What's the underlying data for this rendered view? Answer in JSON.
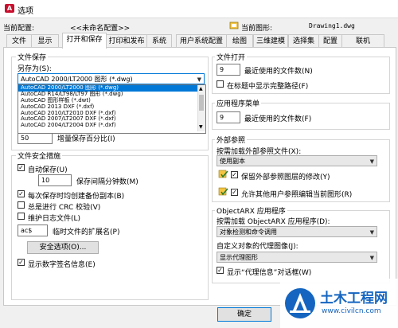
{
  "window": {
    "title": "选项"
  },
  "profile": {
    "current_profile_label": "当前配置:",
    "current_profile_value": "<<未命名配置>>",
    "current_drawing_label": "当前图形:",
    "current_drawing_value": "Drawing1.dwg"
  },
  "tabs": [
    {
      "label": "文件"
    },
    {
      "label": "显示"
    },
    {
      "label": "打开和保存"
    },
    {
      "label": "打印和发布"
    },
    {
      "label": "系统"
    },
    {
      "label": "用户系统配置"
    },
    {
      "label": "绘图"
    },
    {
      "label": "三维建模"
    },
    {
      "label": "选择集"
    },
    {
      "label": "配置"
    },
    {
      "label": "联机"
    }
  ],
  "file_save": {
    "title": "文件保存",
    "save_as_label": "另存为(S):",
    "save_as_value": "AutoCAD 2000/LT2000 图形 (*.dwg)",
    "options": [
      "AutoCAD 2000/LT2000 图形 (*.dwg)",
      "AutoCAD R14/LT98/LT97 图形 (*.dwg)",
      "AutoCAD 图形样板 (*.dwt)",
      "AutoCAD 2013 DXF (*.dxf)",
      "AutoCAD 2010/LT2010 DXF (*.dxf)",
      "AutoCAD 2007/LT2007 DXF (*.dxf)",
      "AutoCAD 2004/LT2004 DXF (*.dxf)"
    ],
    "incremental_value": "50",
    "incremental_label": "增量保存百分比(I)"
  },
  "safety": {
    "title": "文件安全措施",
    "autosave_label": "自动保存(U)",
    "autosave_minutes_value": "10",
    "autosave_minutes_label": "保存间隔分钟数(M)",
    "backup_label": "每次保存时均创建备份副本(B)",
    "crc_label": "总是进行 CRC 校验(V)",
    "log_label": "维护日志文件(L)",
    "temp_ext_value": "ac$",
    "temp_ext_label": "临时文件的扩展名(P)",
    "security_button": "安全选项(O)...",
    "digital_sig_label": "显示数字签名信息(E)"
  },
  "file_open": {
    "title": "文件打开",
    "recent_value": "9",
    "recent_label": "最近使用的文件数(N)",
    "fullpath_label": "在标题中显示完整路径(F)"
  },
  "app_menu": {
    "title": "应用程序菜单",
    "recent_value": "9",
    "recent_label": "最近使用的文件数(F)"
  },
  "xref": {
    "title": "外部参照",
    "demand_load_label": "按需加载外部参照文件(X):",
    "demand_load_value": "使用副本",
    "retain_label": "保留外部参照图层的修改(Y)",
    "allow_edit_label": "允许其他用户参照编辑当前图形(R)"
  },
  "objectarx": {
    "title": "ObjectARX 应用程序",
    "demand_load_label": "按需加载 ObjectARX 应用程序(D):",
    "demand_load_value": "对象检测和命令调用",
    "proxy_label": "自定义对象的代理图像(J):",
    "proxy_value": "显示代理图形",
    "proxy_info_label": "显示“代理信息”对话框(W)"
  },
  "footer": {
    "ok_label": "确定"
  },
  "watermark": {
    "brand": "土木工程网",
    "url": "www.civilcn.com"
  },
  "colors": {
    "accent": "#0078d7",
    "watermark_blue": "#1565c0"
  }
}
